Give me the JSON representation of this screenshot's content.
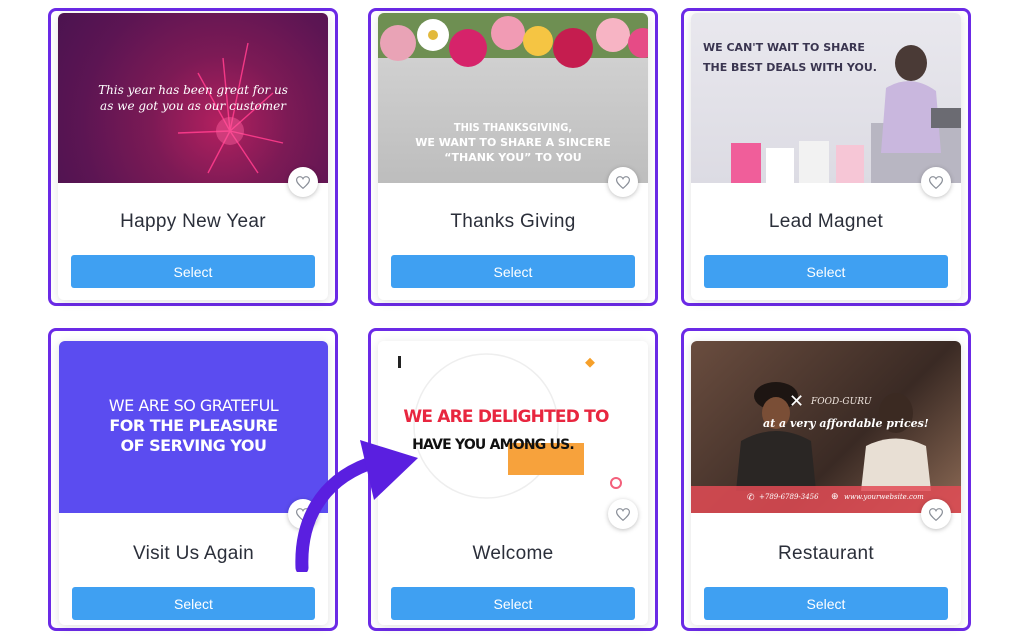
{
  "cards": [
    {
      "title": "Happy New Year",
      "select_label": "Select",
      "image_text": {
        "line1": "This year has been great for us",
        "line2": "as we got you as our customer"
      }
    },
    {
      "title": "Thanks Giving",
      "select_label": "Select",
      "image_text": {
        "line1": "THIS THANKSGIVING,",
        "line2": "WE WANT TO SHARE A SINCERE",
        "line3": "“THANK YOU” TO YOU"
      }
    },
    {
      "title": "Lead Magnet",
      "select_label": "Select",
      "image_text": {
        "line1": "WE CAN'T WAIT TO SHARE",
        "line2": "THE BEST DEALS WITH YOU."
      }
    },
    {
      "title": "Visit Us Again",
      "select_label": "Select",
      "image_text": {
        "line1": "WE ARE SO GRATEFUL",
        "line2": "FOR THE PLEASURE",
        "line3": "OF SERVING YOU"
      }
    },
    {
      "title": "Welcome",
      "select_label": "Select",
      "image_text": {
        "line1": "WE ARE DELIGHTED TO",
        "line2": "HAVE YOU AMONG US."
      }
    },
    {
      "title": "Restaurant",
      "select_label": "Select",
      "image_text": {
        "brand": "FOOD-GURU",
        "tagline": "at a very affordable prices!",
        "phone": "+789-6789-3456",
        "website": "www.yourwebsite.com"
      }
    }
  ],
  "icons": {
    "favorite": "heart-icon",
    "pointer": "curved-arrow-icon"
  },
  "colors": {
    "card_border": "#6b2ae6",
    "select_button": "#3fa0f2",
    "arrow": "#5a1fe0"
  }
}
